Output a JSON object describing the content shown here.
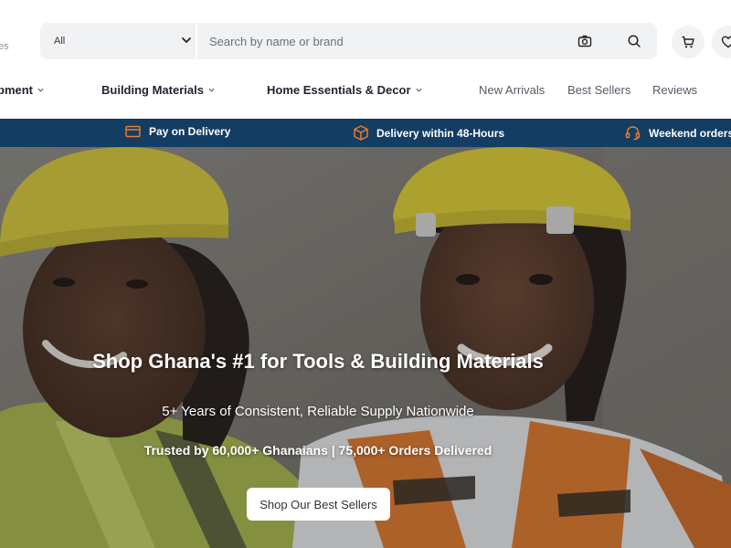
{
  "header": {
    "logo_fragment": "es",
    "category_select": {
      "selected": "All"
    },
    "search": {
      "placeholder": "Search by name or brand"
    },
    "icons": {
      "camera": "camera-icon",
      "search": "search-icon",
      "cart": "cart-icon",
      "wishlist": "heart-icon",
      "dropdown": "chevron-down-icon"
    }
  },
  "nav": {
    "categories": [
      {
        "label": "pment"
      },
      {
        "label": "Building Materials"
      },
      {
        "label": "Home Essentials & Decor"
      }
    ],
    "links": [
      {
        "label": "New Arrivals"
      },
      {
        "label": "Best Sellers"
      },
      {
        "label": "Reviews"
      }
    ]
  },
  "benefits": [
    {
      "label": "Pay on Delivery",
      "icon": "credit-card-icon"
    },
    {
      "label": "Delivery within 48-Hours",
      "icon": "package-icon"
    },
    {
      "label": "Weekend orders p",
      "icon": "headset-icon"
    }
  ],
  "hero": {
    "title": "Shop Ghana's #1 for Tools & Building Materials",
    "subtitle": "5+ Years of Consistent, Reliable Supply Nationwide",
    "trust": "Trusted by 60,000+ Ghanaians | 75,000+ Orders Delivered",
    "cta_label": "Shop Our Best Sellers"
  },
  "colors": {
    "strip_bg": "#133d63",
    "accent_orange": "#f07a2b",
    "search_bg": "#f1f2f4"
  }
}
